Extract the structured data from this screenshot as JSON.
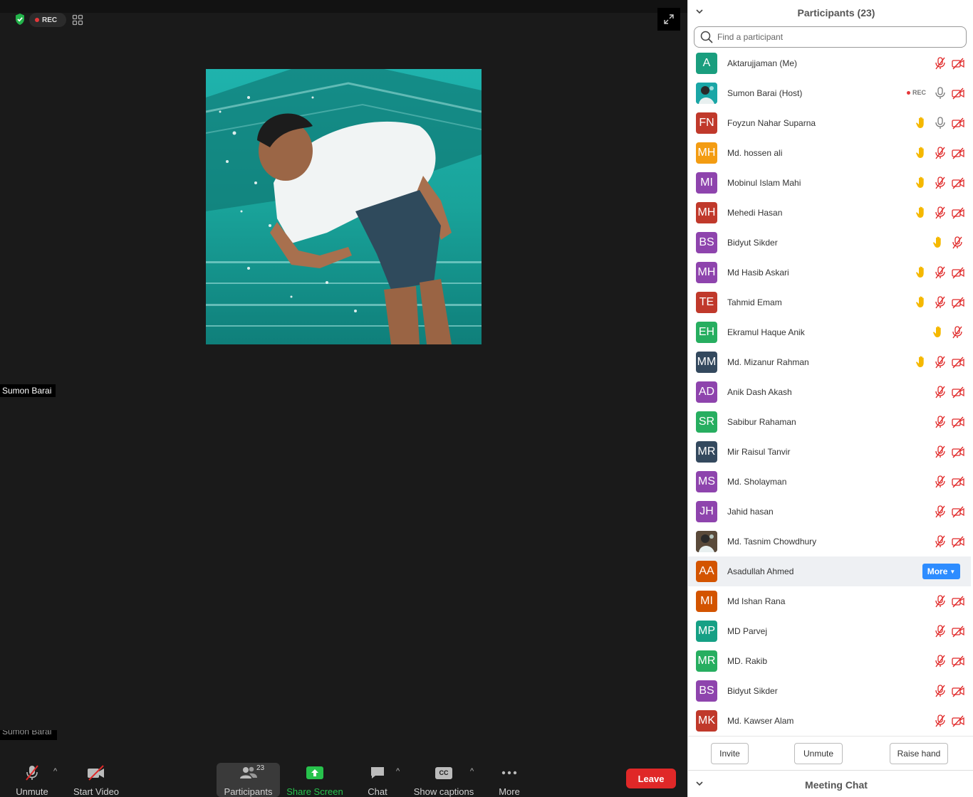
{
  "meeting": {
    "rec_label": "REC",
    "video_name_label": "Sumon Barai",
    "lower_name_label": "Sumon Barai"
  },
  "toolbar": {
    "unmute_label": "Unmute",
    "start_video_label": "Start Video",
    "participants_label": "Participants",
    "participants_count": "23",
    "share_label": "Share Screen",
    "chat_label": "Chat",
    "captions_label": "Show captions",
    "captions_icon_text": "CC",
    "more_label": "More",
    "leave_label": "Leave",
    "share_color": "#27c24c",
    "leave_color": "#e02828"
  },
  "panel": {
    "title": "Participants (23)",
    "search_placeholder": "Find a participant",
    "invite_label": "Invite",
    "unmute_label": "Unmute",
    "raise_hand_label": "Raise hand",
    "chat_title": "Meeting Chat",
    "row_more_label": "More",
    "rec_label": "REC"
  },
  "participants": [
    {
      "initials": "A",
      "name": "Aktarujjaman (Me)",
      "color": "#1a9e7e",
      "hand": false,
      "mic": "muted",
      "video": "off"
    },
    {
      "initials": "",
      "name": "Sumon Barai (Host)",
      "color": "#1aa6a6",
      "photo": true,
      "rec": true,
      "hand": false,
      "mic": "on",
      "video": "off"
    },
    {
      "initials": "FN",
      "name": "Foyzun Nahar Suparna",
      "color": "#c0392b",
      "hand": true,
      "mic": "on",
      "video": "off"
    },
    {
      "initials": "MH",
      "name": "Md. hossen ali",
      "color": "#f39c12",
      "hand": true,
      "mic": "muted",
      "video": "off"
    },
    {
      "initials": "MI",
      "name": "Mobinul Islam Mahi",
      "color": "#8e44ad",
      "hand": true,
      "mic": "muted",
      "video": "off"
    },
    {
      "initials": "MH",
      "name": "Mehedi Hasan",
      "color": "#c0392b",
      "hand": true,
      "mic": "muted",
      "video": "off"
    },
    {
      "initials": "BS",
      "name": "Bidyut Sikder",
      "color": "#8e44ad",
      "hand": true,
      "mic": "muted",
      "video": "none"
    },
    {
      "initials": "MH",
      "name": "Md Hasib Askari",
      "color": "#8e44ad",
      "hand": true,
      "mic": "muted",
      "video": "off"
    },
    {
      "initials": "TE",
      "name": "Tahmid Emam",
      "color": "#c0392b",
      "hand": true,
      "mic": "muted",
      "video": "off"
    },
    {
      "initials": "EH",
      "name": "Ekramul Haque Anik",
      "color": "#27ae60",
      "hand": true,
      "mic": "muted",
      "video": "none"
    },
    {
      "initials": "MM",
      "name": "Md. Mizanur Rahman",
      "color": "#34495e",
      "hand": true,
      "mic": "muted",
      "video": "off"
    },
    {
      "initials": "AD",
      "name": "Anik Dash Akash",
      "color": "#8e44ad",
      "hand": false,
      "mic": "muted",
      "video": "off"
    },
    {
      "initials": "SR",
      "name": "Sabibur Rahaman",
      "color": "#27ae60",
      "hand": false,
      "mic": "muted",
      "video": "off"
    },
    {
      "initials": "MR",
      "name": "Mir Raisul Tanvir",
      "color": "#34495e",
      "hand": false,
      "mic": "muted",
      "video": "off"
    },
    {
      "initials": "MS",
      "name": "Md. Sholayman",
      "color": "#8e44ad",
      "hand": false,
      "mic": "muted",
      "video": "off"
    },
    {
      "initials": "JH",
      "name": "Jahid hasan",
      "color": "#8e44ad",
      "hand": false,
      "mic": "muted",
      "video": "off"
    },
    {
      "initials": "",
      "name": "Md. Tasnim Chowdhury",
      "color": "#5a4a3a",
      "photo": true,
      "hand": false,
      "mic": "muted",
      "video": "off"
    },
    {
      "initials": "AA",
      "name": "Asadullah Ahmed",
      "color": "#d35400",
      "hand": false,
      "hover": true,
      "mic": "none",
      "video": "none"
    },
    {
      "initials": "MI",
      "name": "Md Ishan Rana",
      "color": "#d35400",
      "hand": false,
      "mic": "muted",
      "video": "off"
    },
    {
      "initials": "MP",
      "name": "MD Parvej",
      "color": "#16a085",
      "hand": false,
      "mic": "muted",
      "video": "off"
    },
    {
      "initials": "MR",
      "name": "MD. Rakib",
      "color": "#27ae60",
      "hand": false,
      "mic": "muted",
      "video": "off"
    },
    {
      "initials": "BS",
      "name": "Bidyut Sikder",
      "color": "#8e44ad",
      "hand": false,
      "mic": "muted",
      "video": "off"
    },
    {
      "initials": "MK",
      "name": "Md. Kawser Alam",
      "color": "#c0392b",
      "hand": false,
      "mic": "muted",
      "video": "off"
    }
  ]
}
